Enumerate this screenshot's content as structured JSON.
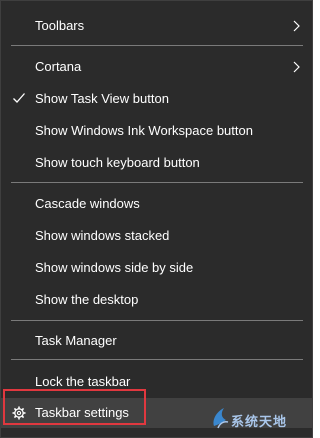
{
  "menu": {
    "items": [
      {
        "label": "Toolbars",
        "has_submenu": true,
        "checked": false
      },
      {
        "label": "Cortana",
        "has_submenu": true,
        "checked": false
      },
      {
        "label": "Show Task View button",
        "has_submenu": false,
        "checked": true
      },
      {
        "label": "Show Windows Ink Workspace button",
        "has_submenu": false,
        "checked": false
      },
      {
        "label": "Show touch keyboard button",
        "has_submenu": false,
        "checked": false
      },
      {
        "label": "Cascade windows",
        "has_submenu": false,
        "checked": false
      },
      {
        "label": "Show windows stacked",
        "has_submenu": false,
        "checked": false
      },
      {
        "label": "Show windows side by side",
        "has_submenu": false,
        "checked": false
      },
      {
        "label": "Show the desktop",
        "has_submenu": false,
        "checked": false
      },
      {
        "label": "Task Manager",
        "has_submenu": false,
        "checked": false
      },
      {
        "label": "Lock the taskbar",
        "has_submenu": false,
        "checked": false
      },
      {
        "label": "Taskbar settings",
        "has_submenu": false,
        "checked": false,
        "icon": "gear-icon"
      }
    ]
  },
  "watermark": {
    "text": "系统天地"
  },
  "colors": {
    "menu_background": "#2b2b2b",
    "separator": "#7a7a7a",
    "highlight_border": "#e0383f",
    "text": "#ffffff"
  }
}
